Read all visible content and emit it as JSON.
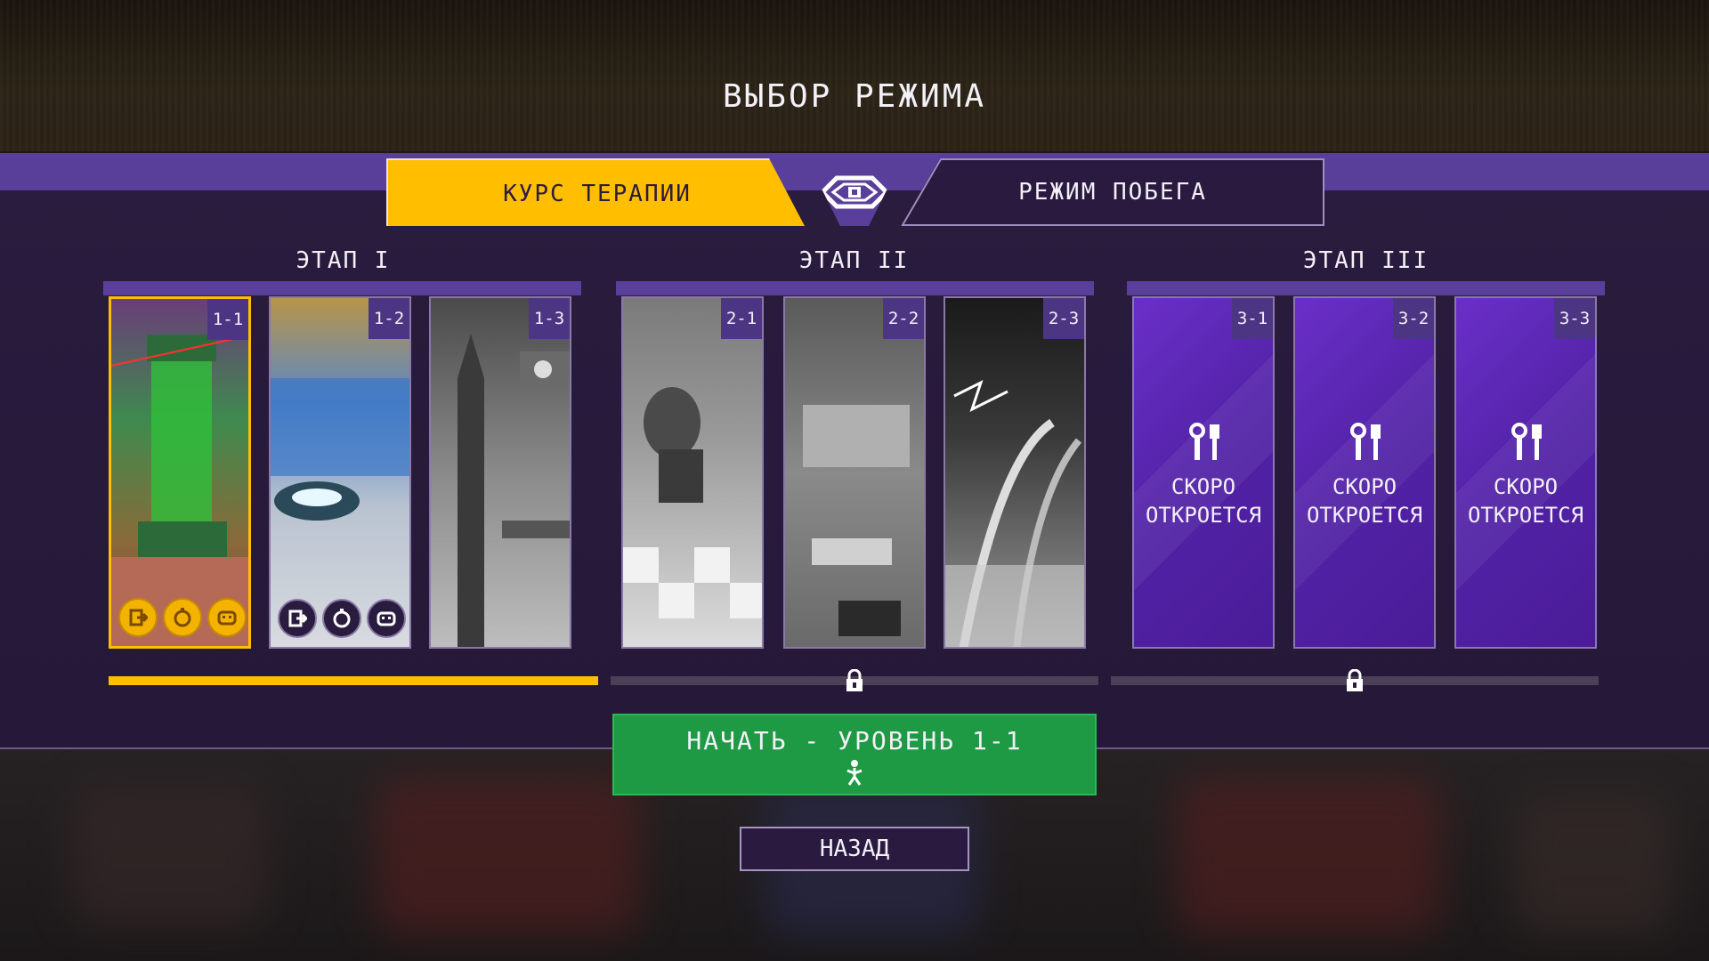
{
  "title": "ВЫБОР РЕЖИМА",
  "tabs": [
    {
      "label": "КУРС ТЕРАПИИ",
      "active": true
    },
    {
      "label": "РЕЖИМ ПОБЕГА",
      "active": false
    }
  ],
  "stages": [
    {
      "title": "ЭТАП I",
      "unlocked": true,
      "progress": 1.0,
      "levels": [
        {
          "label": "1-1",
          "selected": true,
          "badges": "gold"
        },
        {
          "label": "1-2",
          "selected": false,
          "badges": "dark"
        },
        {
          "label": "1-3",
          "selected": false
        }
      ]
    },
    {
      "title": "ЭТАП II",
      "unlocked": false,
      "progress": 0,
      "levels": [
        {
          "label": "2-1"
        },
        {
          "label": "2-2"
        },
        {
          "label": "2-3"
        }
      ]
    },
    {
      "title": "ЭТАП III",
      "unlocked": false,
      "progress": 0,
      "levels": [
        {
          "label": "3-1",
          "status": "СКОРО ОТКРОЕТСЯ"
        },
        {
          "label": "3-2",
          "status": "СКОРО ОТКРОЕТСЯ"
        },
        {
          "label": "3-3",
          "status": "СКОРО ОТКРОЕТСЯ"
        }
      ]
    }
  ],
  "soon_lines": [
    "СКОРО",
    "ОТКРОЕТСЯ"
  ],
  "start_button": {
    "label": "НАЧАТЬ - УРОВЕНЬ 1-1"
  },
  "back_button": {
    "label": "НАЗАД"
  },
  "colors": {
    "accent": "#ffbf00",
    "panel": "#2a1c3e",
    "band": "#5a3f9a",
    "start": "#1e9a44",
    "coming_soon": "#5a24b0"
  }
}
